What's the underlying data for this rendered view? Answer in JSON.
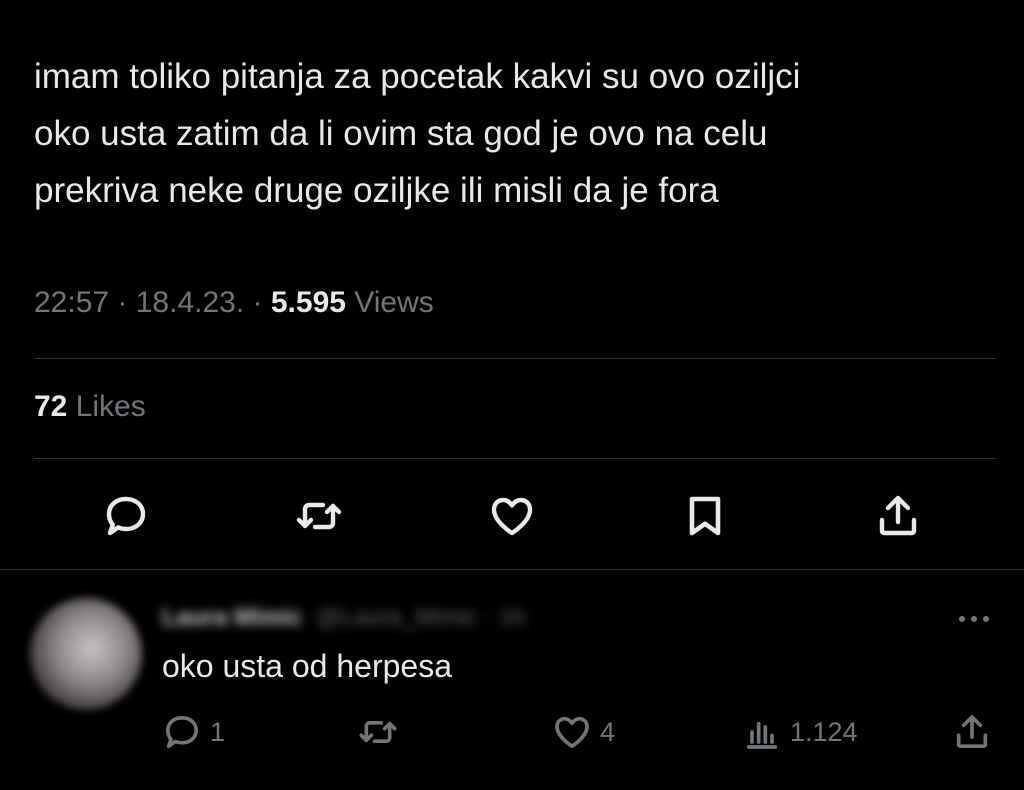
{
  "tweet": {
    "text_lines": [
      "imam toliko pitanja za pocetak kakvi su ovo oziljci",
      "oko usta zatim da li ovim sta god je ovo na celu",
      "prekriva neke druge oziljke ili misli da je fora"
    ],
    "time": "22:57",
    "sep1": " · ",
    "date": "18.4.23.",
    "sep2": " · ",
    "views_count": "5.595",
    "views_label": " Views",
    "likes_count": "72",
    "likes_label": " Likes"
  },
  "actions": [
    {
      "icon": "reply-icon"
    },
    {
      "icon": "retweet-icon"
    },
    {
      "icon": "like-icon"
    },
    {
      "icon": "bookmark-icon"
    },
    {
      "icon": "share-icon"
    }
  ],
  "reply": {
    "name": "Laura Mimic",
    "handle": "@Laura_Mimic · 1h",
    "text": "oko usta od herpesa",
    "reply_count": "1",
    "like_count": "4",
    "views_count": "1.124"
  },
  "colors": {
    "background": "#000000",
    "text": "#e7e9ea",
    "muted": "#71767b",
    "divider": "#2f3336"
  }
}
